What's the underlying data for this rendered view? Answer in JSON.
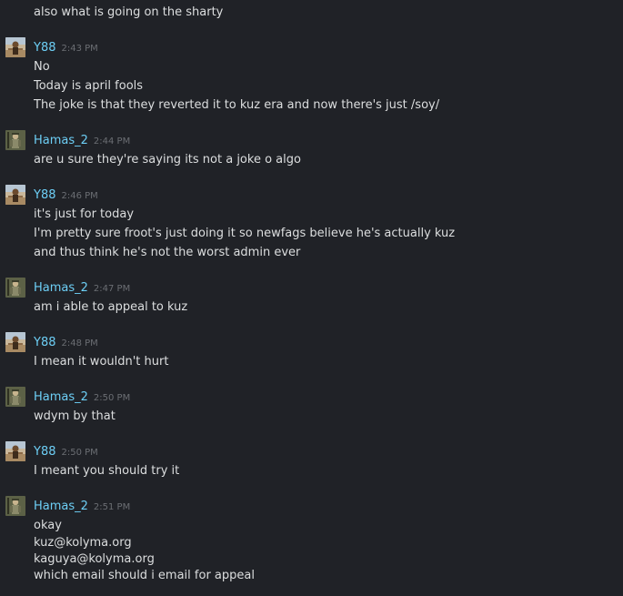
{
  "partial_line": "also what is going on the sharty",
  "users": {
    "r88": {
      "name": "Ү88",
      "avatar": "avatar-desert"
    },
    "hamas": {
      "name": "Hamas_2",
      "avatar": "avatar-soldier"
    }
  },
  "messages": [
    {
      "author": "Ү88",
      "time": "2:43 PM",
      "lines": [
        "No",
        "Today is april fools",
        "The joke is that they reverted it to kuz era and now there's just /soy/"
      ]
    },
    {
      "author": "Hamas_2",
      "time": "2:44 PM",
      "lines": [
        "are u sure they're saying its not a joke o algo"
      ]
    },
    {
      "author": "Ү88",
      "time": "2:46 PM",
      "lines": [
        "it's just for today",
        "I'm pretty sure froot's just doing it so newfags believe he's actually kuz",
        "and thus think he's not the worst admin ever"
      ]
    },
    {
      "author": "Hamas_2",
      "time": "2:47 PM",
      "lines": [
        "am i able to appeal to kuz"
      ]
    },
    {
      "author": "Ү88",
      "time": "2:48 PM",
      "lines": [
        "I mean it wouldn't hurt"
      ]
    },
    {
      "author": "Hamas_2",
      "time": "2:50 PM",
      "lines": [
        "wdym by that"
      ]
    },
    {
      "author": "Ү88",
      "time": "2:50 PM",
      "lines": [
        "I meant you should try it"
      ]
    },
    {
      "author": "Hamas_2",
      "time": "2:51 PM",
      "lines": [
        "okay",
        "kuz@kolyma.org",
        "kaguya@kolyma.org",
        "which email should i email for appeal"
      ]
    }
  ],
  "colors": {
    "background": "#202227",
    "author": "#6dcff6",
    "text": "#dcdedf",
    "timestamp": "#6b6e73"
  }
}
